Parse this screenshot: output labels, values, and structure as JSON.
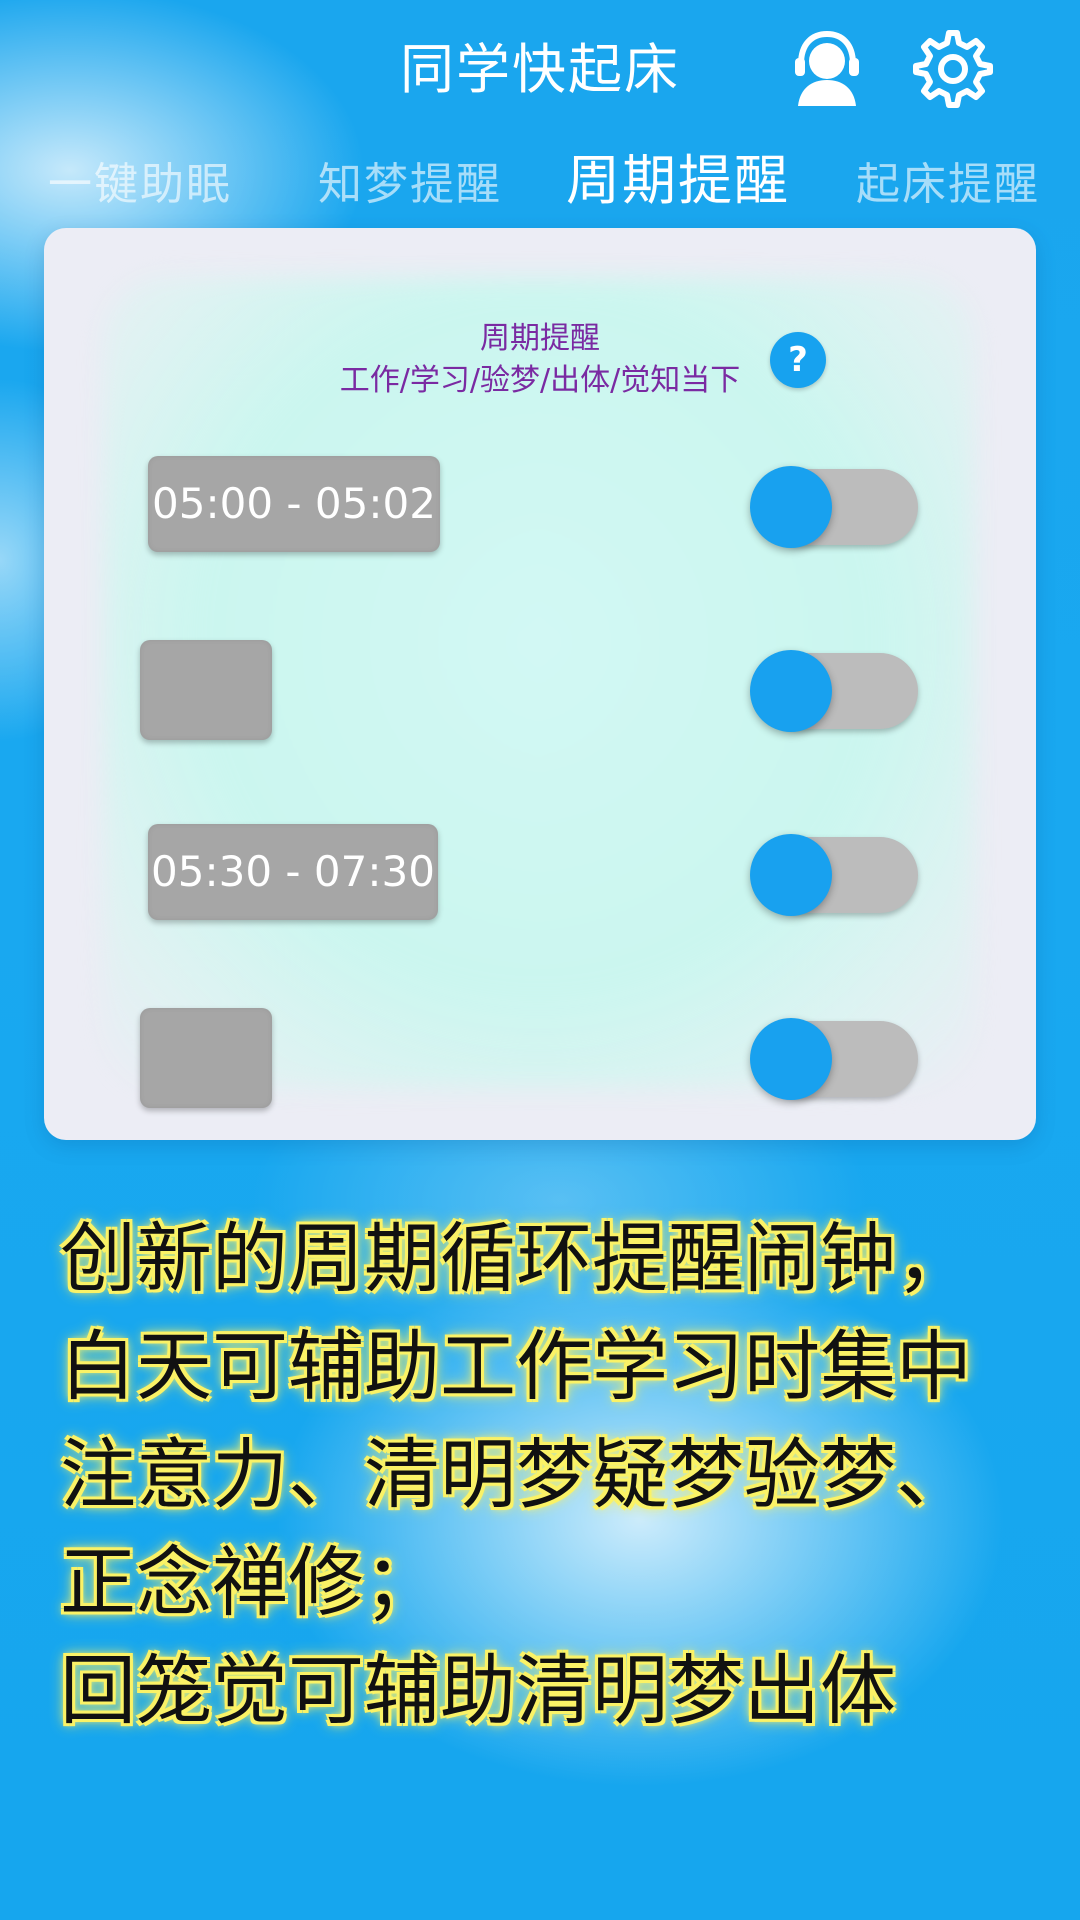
{
  "header": {
    "title": "同学快起床",
    "support_icon": "customer-service-headset-icon",
    "settings_icon": "gear-icon"
  },
  "tabs": [
    {
      "label": "一键助眠",
      "active": false
    },
    {
      "label": "知梦提醒",
      "active": false
    },
    {
      "label": "周期提醒",
      "active": true
    },
    {
      "label": "起床提醒",
      "active": false
    }
  ],
  "card": {
    "title": "周期提醒",
    "subtitle": "工作/学习/验梦/出体/觉知当下",
    "help_label": "?",
    "rows": [
      {
        "time": "05:00 - 05:02",
        "enabled": false
      },
      {
        "time": "",
        "enabled": false
      },
      {
        "time": "05:30 - 07:30",
        "enabled": false
      },
      {
        "time": "",
        "enabled": false
      }
    ]
  },
  "promo": {
    "lines": [
      "创新的周期循环提醒闹钟，",
      "白天可辅助工作学习时集中",
      "注意力、清明梦疑梦验梦、",
      "正念禅修；",
      "回笼觉可辅助清明梦出体"
    ]
  },
  "colors": {
    "background": "#12a4ee",
    "accent": "#18a1ef",
    "card": "#ecedf5",
    "card_title": "#7a2aa2",
    "toggle_track": "#bcbcbc",
    "time_box": "#a6a6a6",
    "promo_glow": "#fbf36a"
  }
}
